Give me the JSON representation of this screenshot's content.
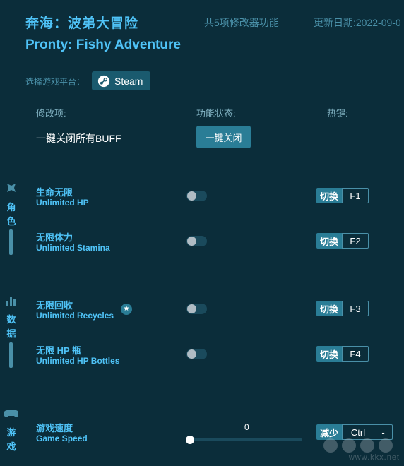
{
  "header": {
    "title_cn": "奔海：波弟大冒险",
    "feature_count": "共5项修改器功能",
    "update_date": "更新日期:2022-09-0",
    "title_en": "Pronty: Fishy Adventure"
  },
  "platform": {
    "label": "选择游戏平台：",
    "selected": "Steam"
  },
  "columns": {
    "mod": "修改项:",
    "status": "功能状态:",
    "hotkey": "热键:"
  },
  "killall": {
    "label": "一键关闭所有BUFF",
    "button": "一键关闭"
  },
  "categories": [
    {
      "label": "角色",
      "icon": "character-icon",
      "items": [
        {
          "cn": "生命无限",
          "en": "Unlimited HP",
          "enabled": false,
          "action": "切换",
          "key": "F1"
        },
        {
          "cn": "无限体力",
          "en": "Unlimited Stamina",
          "enabled": false,
          "action": "切换",
          "key": "F2"
        }
      ]
    },
    {
      "label": "数据",
      "icon": "stats-icon",
      "items": [
        {
          "cn": "无限回收",
          "en": "Unlimited Recycles",
          "enabled": false,
          "starred": true,
          "action": "切换",
          "key": "F3"
        },
        {
          "cn": "无限 HP 瓶",
          "en": "Unlimited HP Bottles",
          "enabled": false,
          "action": "切换",
          "key": "F4"
        }
      ]
    },
    {
      "label": "游戏",
      "icon": "gamepad-icon",
      "items": [
        {
          "cn": "游戏速度",
          "en": "Game Speed",
          "value": "0",
          "action": "减少",
          "key": "Ctrl",
          "key2": "-"
        }
      ]
    }
  ],
  "watermark": "www.kkx.net",
  "colors": {
    "background": "#0b2d3a",
    "accent": "#4fc3f7",
    "button": "#2a7d96"
  }
}
